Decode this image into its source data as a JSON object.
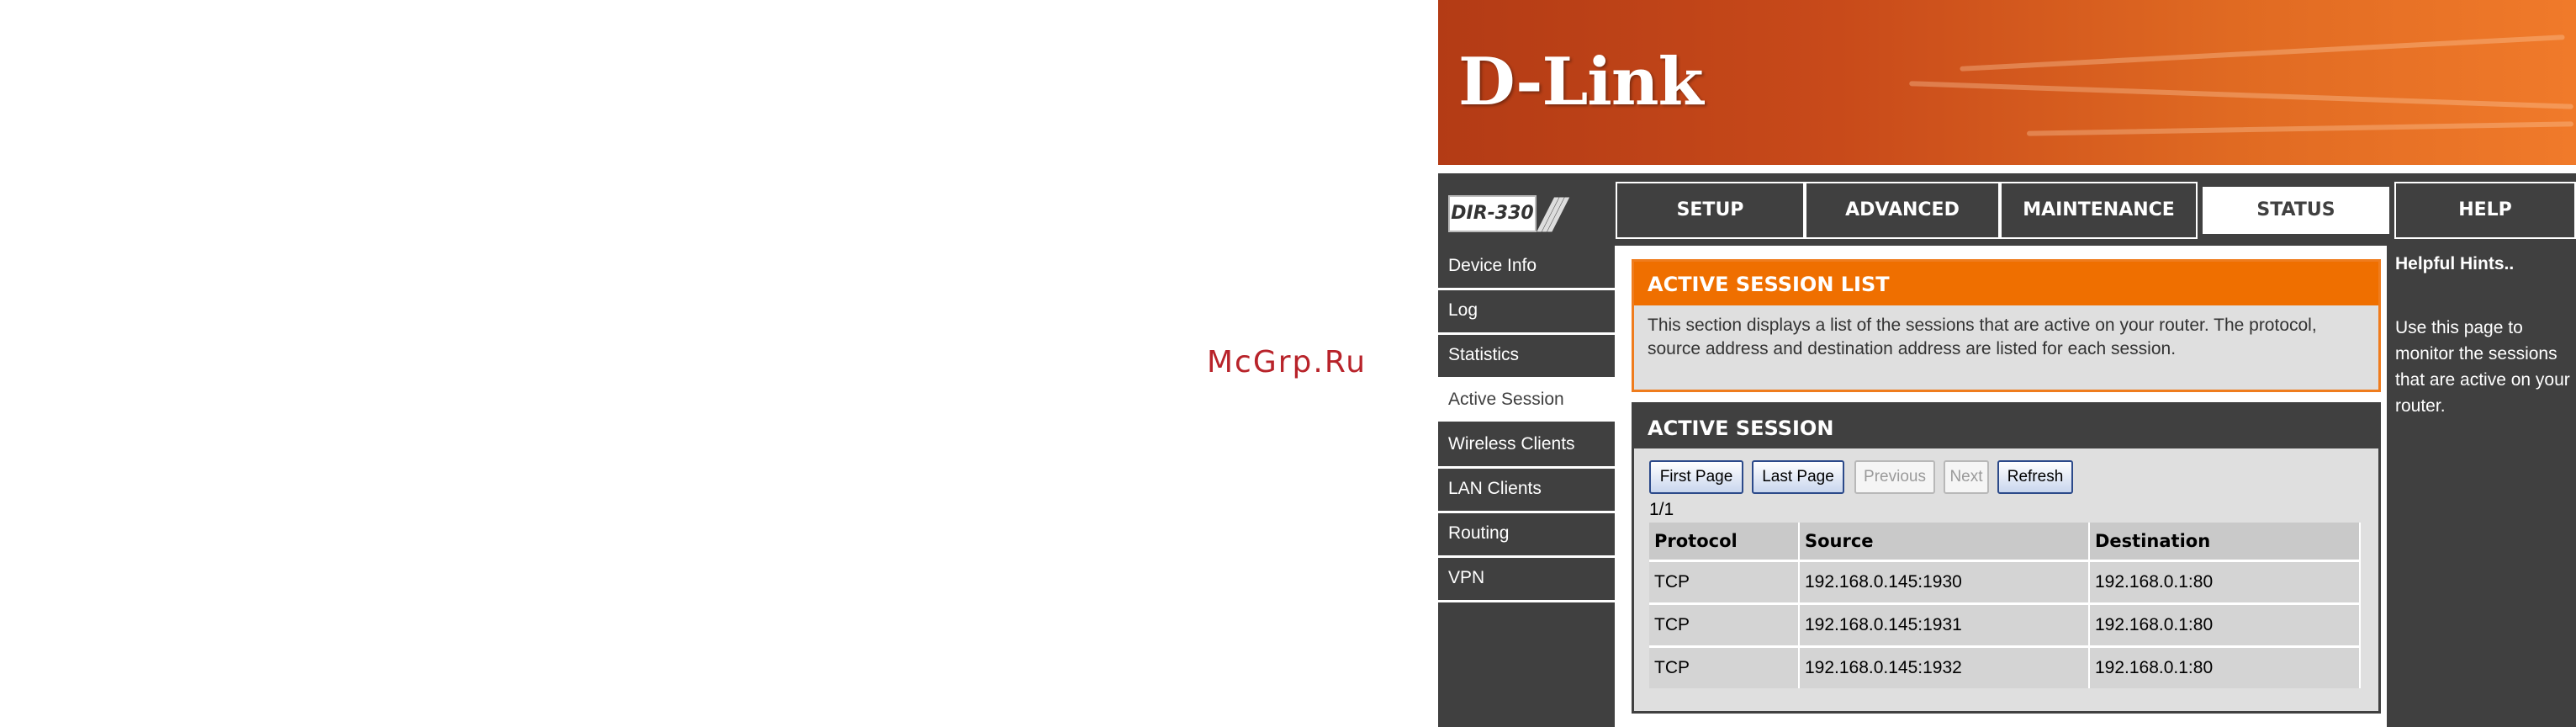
{
  "watermark": "McGrp.Ru",
  "brand": {
    "logo": "D-Link",
    "model": "DIR-330"
  },
  "nav": {
    "tabs": [
      "SETUP",
      "ADVANCED",
      "MAINTENANCE",
      "STATUS",
      "HELP"
    ],
    "active_tab": "STATUS"
  },
  "sidebar": {
    "items": [
      "Device Info",
      "Log",
      "Statistics",
      "Active Session",
      "Wireless Clients",
      "LAN Clients",
      "Routing",
      "VPN"
    ],
    "active": "Active Session"
  },
  "intro": {
    "title": "ACTIVE SESSION LIST",
    "description": "This section displays a list of the sessions that are active on your router. The protocol, source address and destination address are listed for each session."
  },
  "session": {
    "title": "ACTIVE SESSION",
    "buttons": {
      "first": "First Page",
      "last": "Last Page",
      "previous": "Previous",
      "next": "Next",
      "refresh": "Refresh"
    },
    "page": "1/1",
    "columns": [
      "Protocol",
      "Source",
      "Destination"
    ],
    "rows": [
      [
        "TCP",
        "192.168.0.145:1930",
        "192.168.0.1:80"
      ],
      [
        "TCP",
        "192.168.0.145:1931",
        "192.168.0.1:80"
      ],
      [
        "TCP",
        "192.168.0.145:1932",
        "192.168.0.1:80"
      ]
    ]
  },
  "hints": {
    "title": "Helpful Hints..",
    "text": "Use this page to monitor the sessions that are active on your router."
  },
  "colors": {
    "accent": "#ef6f00",
    "dark": "#404040"
  }
}
